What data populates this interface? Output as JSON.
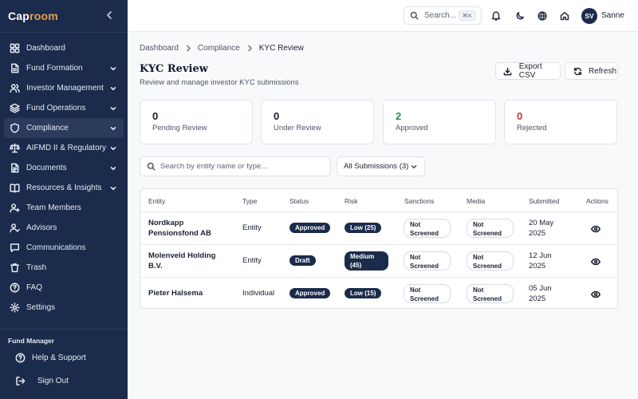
{
  "app": {
    "logo_part1": "Cap",
    "logo_part2": "room"
  },
  "sidebar": {
    "items": [
      {
        "label": "Dashboard",
        "icon": "grid-icon",
        "expandable": false
      },
      {
        "label": "Fund Formation",
        "icon": "file-icon",
        "expandable": true
      },
      {
        "label": "Investor Management",
        "icon": "users-icon",
        "expandable": true
      },
      {
        "label": "Fund Operations",
        "icon": "layers-icon",
        "expandable": true
      },
      {
        "label": "Compliance",
        "icon": "shield-icon",
        "expandable": true,
        "active": true
      },
      {
        "label": "AIFMD II & Regulatory",
        "icon": "scale-icon",
        "expandable": true
      },
      {
        "label": "Documents",
        "icon": "document-icon",
        "expandable": true
      },
      {
        "label": "Resources & Insights",
        "icon": "book-icon",
        "expandable": true
      },
      {
        "label": "Team Members",
        "icon": "user-plus-icon",
        "expandable": false
      },
      {
        "label": "Advisors",
        "icon": "user-check-icon",
        "expandable": false
      },
      {
        "label": "Communications",
        "icon": "message-icon",
        "expandable": false
      },
      {
        "label": "Trash",
        "icon": "trash-icon",
        "expandable": false
      },
      {
        "label": "FAQ",
        "icon": "help-circle-icon",
        "expandable": false
      },
      {
        "label": "Settings",
        "icon": "gear-icon",
        "expandable": false
      }
    ],
    "section_label": "Fund Manager",
    "help_label": "Help & Support",
    "signout_label": "Sign Out"
  },
  "topbar": {
    "search_placeholder": "Search...",
    "search_shortcut": "⌘K",
    "avatar_initials": "SV",
    "username": "Sanne"
  },
  "breadcrumb": [
    "Dashboard",
    "Compliance",
    "KYC Review"
  ],
  "page": {
    "title": "KYC Review",
    "subtitle": "Review and manage investor KYC submissions",
    "export_label": "Export CSV",
    "refresh_label": "Refresh"
  },
  "stats": [
    {
      "value": "0",
      "label": "Pending Review",
      "color": "#121a2b"
    },
    {
      "value": "0",
      "label": "Under Review",
      "color": "#121a2b"
    },
    {
      "value": "2",
      "label": "Approved",
      "color": "#2f8a52"
    },
    {
      "value": "0",
      "label": "Rejected",
      "color": "#c0392b"
    }
  ],
  "filters": {
    "search_placeholder": "Search by entity name or type...",
    "submission_filter": "All Submissions (3)"
  },
  "table": {
    "headers": [
      "Entity",
      "Type",
      "Status",
      "Risk",
      "Sanctions",
      "Media",
      "Submitted",
      "Actions"
    ],
    "rows": [
      {
        "entity_l1": "Nordkapp",
        "entity_l2": "Pensionsfond AB",
        "type": "Entity",
        "status": "Approved",
        "risk_l1": "Low (25)",
        "risk_l2": "",
        "sanctions_l1": "Not",
        "sanctions_l2": "Screened",
        "media_l1": "Not",
        "media_l2": "Screened",
        "submitted_l1": "20 May",
        "submitted_l2": "2025"
      },
      {
        "entity_l1": "Molenveld Holding",
        "entity_l2": "B.V.",
        "type": "Entity",
        "status": "Draft",
        "risk_l1": "Medium",
        "risk_l2": "(45)",
        "sanctions_l1": "Not",
        "sanctions_l2": "Screened",
        "media_l1": "Not",
        "media_l2": "Screened",
        "submitted_l1": "12 Jun",
        "submitted_l2": "2025"
      },
      {
        "entity_l1": "Pieter Halsema",
        "entity_l2": "",
        "type": "Individual",
        "status": "Approved",
        "risk_l1": "Low (15)",
        "risk_l2": "",
        "sanctions_l1": "Not",
        "sanctions_l2": "Screened",
        "media_l1": "Not",
        "media_l2": "Screened",
        "submitted_l1": "05 Jun",
        "submitted_l2": "2025"
      }
    ]
  }
}
